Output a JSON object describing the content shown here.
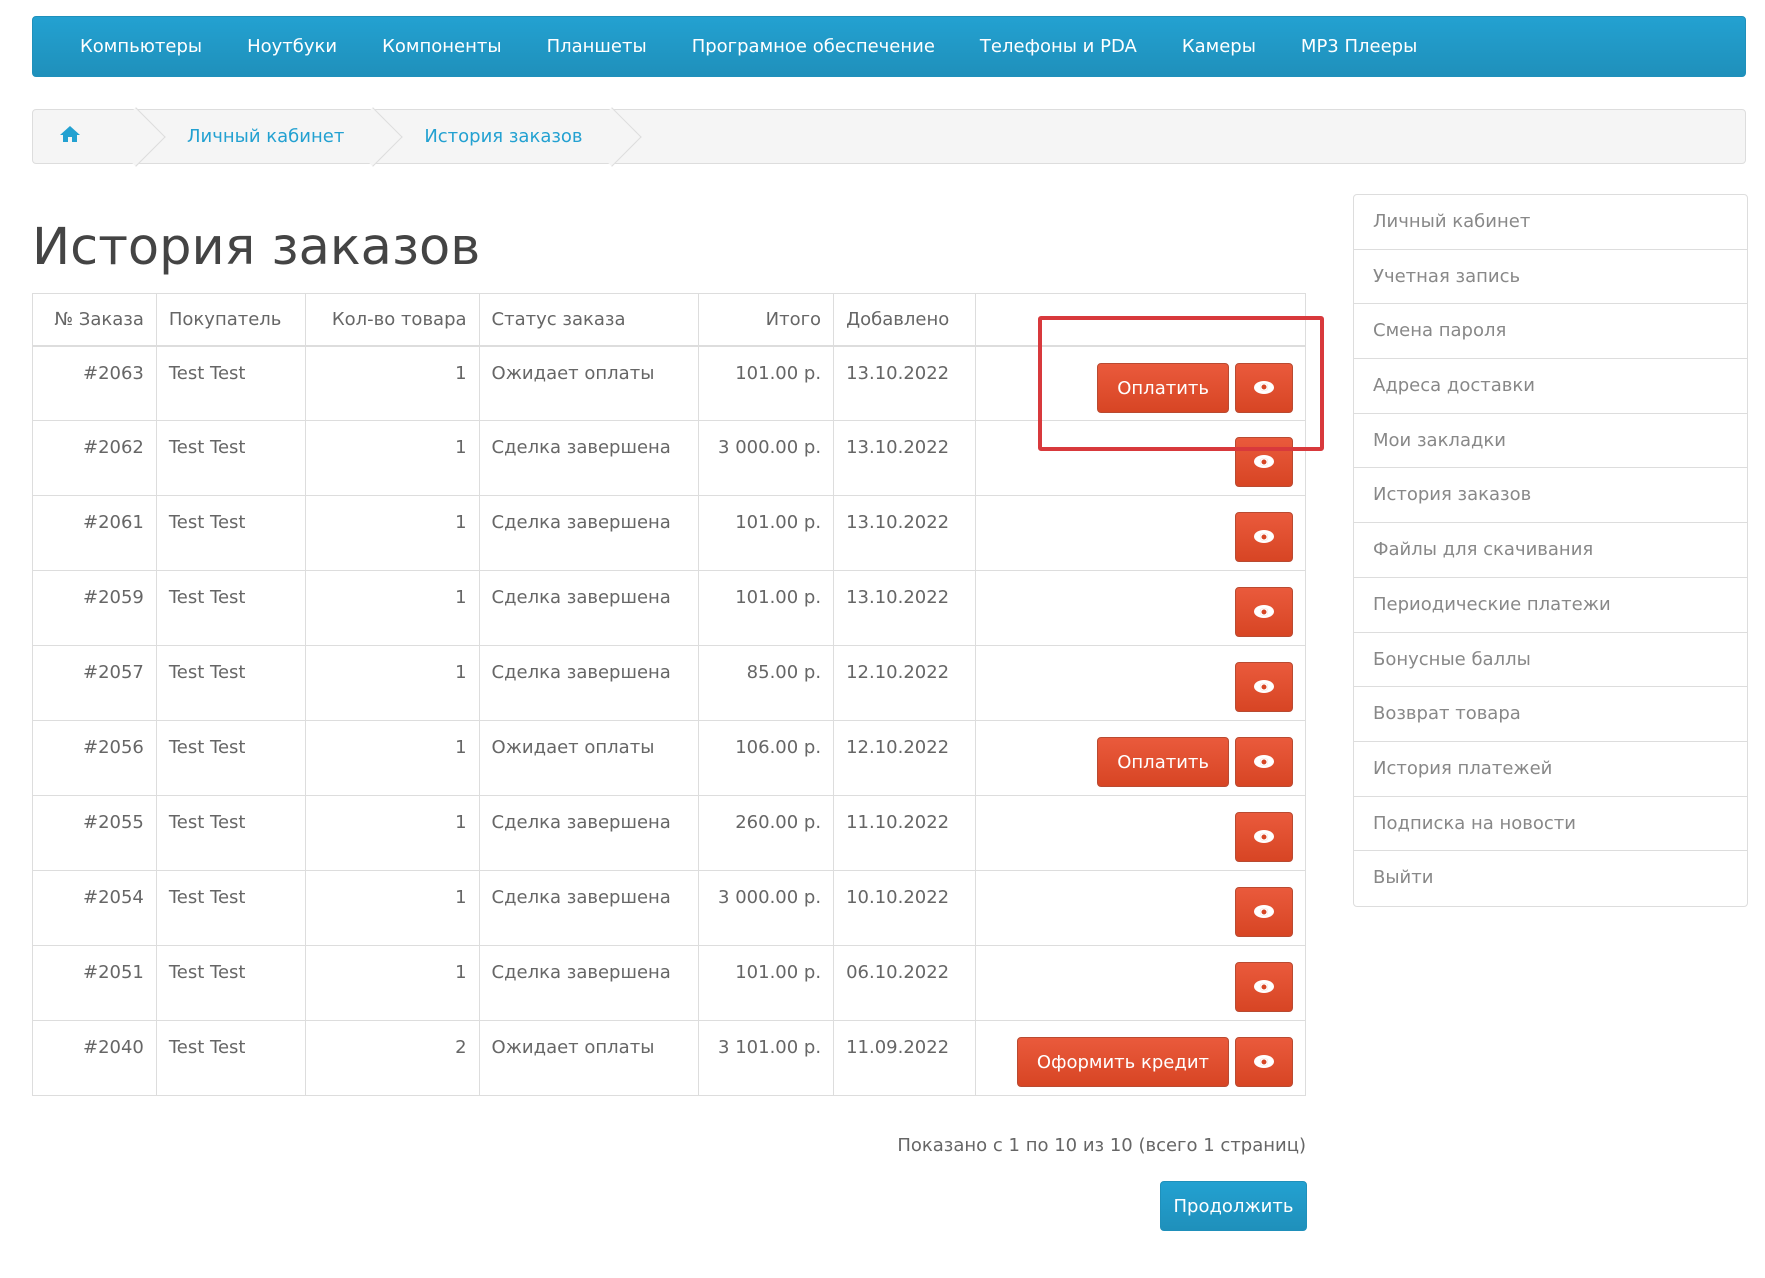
{
  "menu": {
    "items": [
      "Компьютеры",
      "Ноутбуки",
      "Компоненты",
      "Планшеты",
      "Програмное обеспечение",
      "Телефоны и PDA",
      "Камеры",
      "MP3 Плееры"
    ]
  },
  "breadcrumb": {
    "home_icon": "home-icon",
    "items": [
      "Личный кабинет",
      "История заказов"
    ]
  },
  "page": {
    "title": "История заказов"
  },
  "table": {
    "headers": {
      "order_id": "№ Заказа",
      "customer": "Покупатель",
      "quantity": "Кол-во товара",
      "status": "Статус заказа",
      "total": "Итого",
      "date_added": "Добавлено"
    },
    "rows": [
      {
        "order_id": "#2063",
        "customer": "Test Test",
        "quantity": "1",
        "status": "Ожидает оплаты",
        "total": "101.00 р.",
        "date_added": "13.10.2022",
        "action": "Оплатить"
      },
      {
        "order_id": "#2062",
        "customer": "Test Test",
        "quantity": "1",
        "status": "Сделка завершена",
        "total": "3 000.00 р.",
        "date_added": "13.10.2022",
        "action": ""
      },
      {
        "order_id": "#2061",
        "customer": "Test Test",
        "quantity": "1",
        "status": "Сделка завершена",
        "total": "101.00 р.",
        "date_added": "13.10.2022",
        "action": ""
      },
      {
        "order_id": "#2059",
        "customer": "Test Test",
        "quantity": "1",
        "status": "Сделка завершена",
        "total": "101.00 р.",
        "date_added": "13.10.2022",
        "action": ""
      },
      {
        "order_id": "#2057",
        "customer": "Test Test",
        "quantity": "1",
        "status": "Сделка завершена",
        "total": "85.00 р.",
        "date_added": "12.10.2022",
        "action": ""
      },
      {
        "order_id": "#2056",
        "customer": "Test Test",
        "quantity": "1",
        "status": "Ожидает оплаты",
        "total": "106.00 р.",
        "date_added": "12.10.2022",
        "action": "Оплатить"
      },
      {
        "order_id": "#2055",
        "customer": "Test Test",
        "quantity": "1",
        "status": "Сделка завершена",
        "total": "260.00 р.",
        "date_added": "11.10.2022",
        "action": ""
      },
      {
        "order_id": "#2054",
        "customer": "Test Test",
        "quantity": "1",
        "status": "Сделка завершена",
        "total": "3 000.00 р.",
        "date_added": "10.10.2022",
        "action": ""
      },
      {
        "order_id": "#2051",
        "customer": "Test Test",
        "quantity": "1",
        "status": "Сделка завершена",
        "total": "101.00 р.",
        "date_added": "06.10.2022",
        "action": ""
      },
      {
        "order_id": "#2040",
        "customer": "Test Test",
        "quantity": "2",
        "status": "Ожидает оплаты",
        "total": "3 101.00 р.",
        "date_added": "11.09.2022",
        "action": "Оформить кредит"
      }
    ]
  },
  "pagination": {
    "text": "Показано с 1 по 10 из 10 (всего 1 страниц)"
  },
  "continue_label": "Продолжить",
  "sidebar": {
    "items": [
      "Личный кабинет",
      "Учетная запись",
      "Смена пароля",
      "Адреса доставки",
      "Мои закладки",
      "История заказов",
      "Файлы для скачивания",
      "Периодические платежи",
      "Бонусные баллы",
      "Возврат товара",
      "История платежей",
      "Подписка на новости",
      "Выйти"
    ]
  },
  "colors": {
    "accent": "#23a1d1",
    "danger": "#d74524",
    "highlight": "#d8393c"
  }
}
